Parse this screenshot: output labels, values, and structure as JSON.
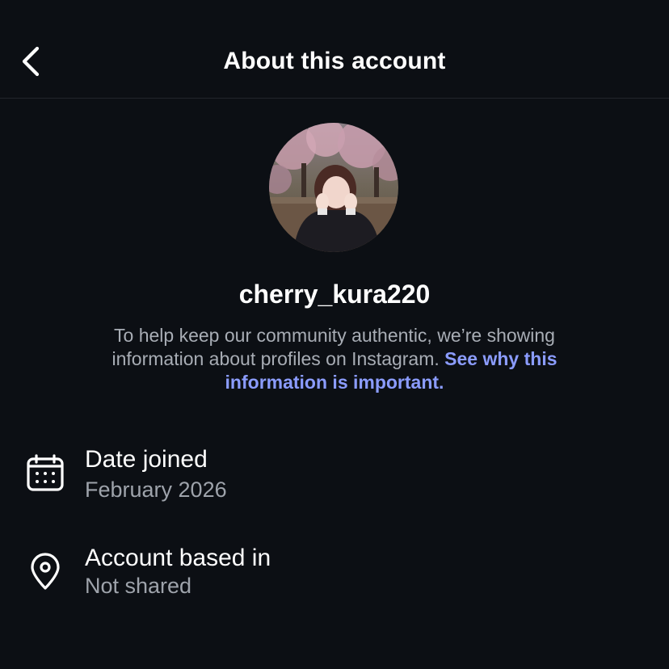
{
  "header": {
    "title": "About this account",
    "back_icon": "chevron-left-icon"
  },
  "profile": {
    "username": "cherry_kura220",
    "avatar_icon": "profile-photo"
  },
  "notice": {
    "text": "To help keep our community authentic, we’re showing information about profiles on Instagram. ",
    "link_text": "See why this information is important."
  },
  "details": [
    {
      "icon": "calendar-icon",
      "label": "Date joined",
      "value": "February 2026"
    },
    {
      "icon": "location-pin-icon",
      "label": "Account based in",
      "value": "Not shared"
    }
  ],
  "colors": {
    "background": "#0c0f14",
    "link": "#8b9cff",
    "secondary_text": "#a8adb5"
  }
}
